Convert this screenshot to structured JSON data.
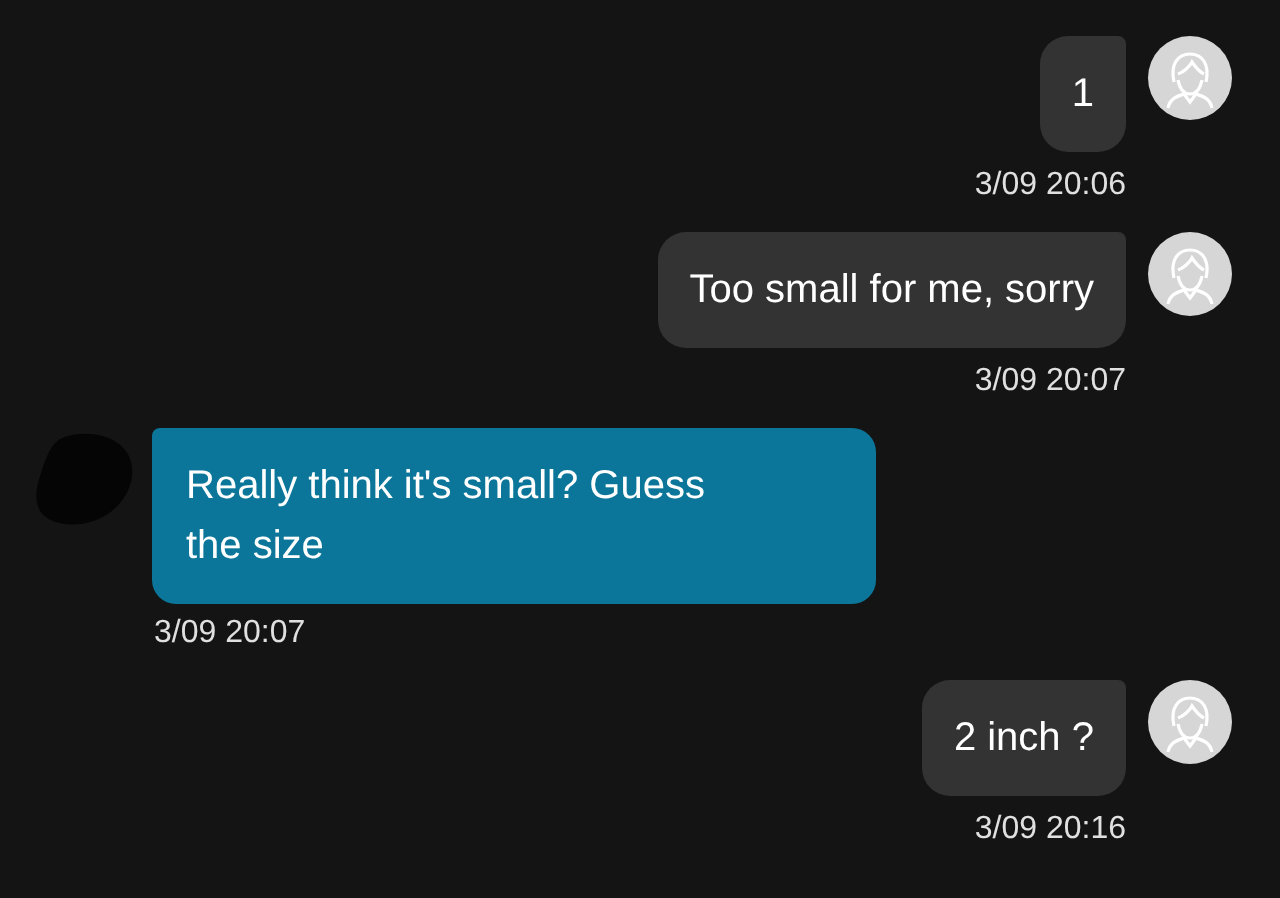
{
  "messages": [
    {
      "kind": "outgoing",
      "text": "1",
      "time": "3/09 20:06"
    },
    {
      "kind": "outgoing",
      "text": "Too small for me, sorry",
      "time": "3/09 20:07"
    },
    {
      "kind": "incoming",
      "text": "Really think it's small? Guess the size",
      "time": "3/09 20:07"
    },
    {
      "kind": "outgoing",
      "text": "2 inch ?",
      "time": "3/09 20:16"
    }
  ]
}
